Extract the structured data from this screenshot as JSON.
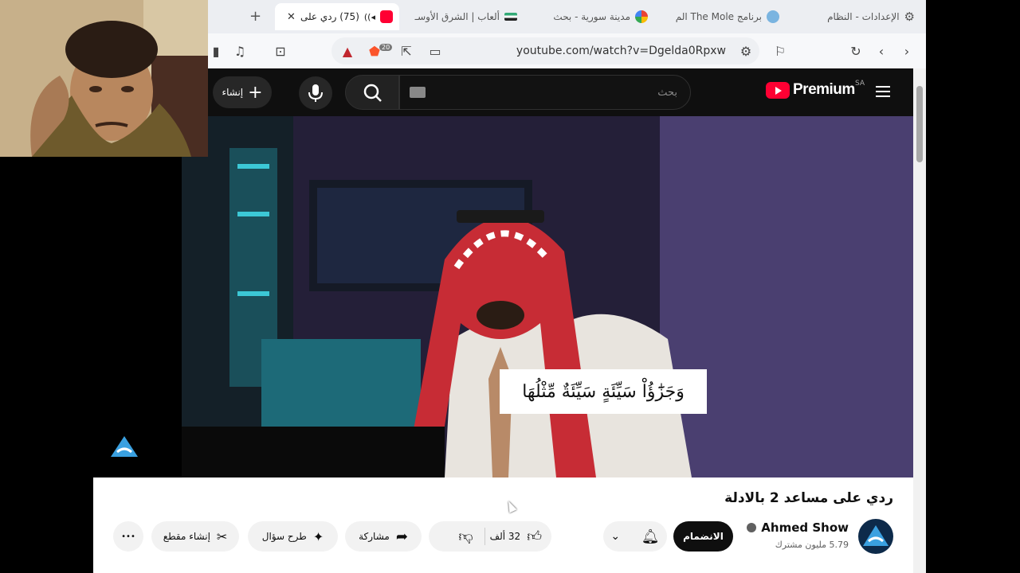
{
  "browser": {
    "tabs": [
      {
        "label": "الإعدادات - النظام",
        "icon": "gear-icon"
      },
      {
        "label": "برنامج The Mole الم",
        "icon": "globe-icon"
      },
      {
        "label": "مدينة سورية - بحث",
        "icon": "google-icon"
      },
      {
        "label": "ألعاب | الشرق الأوسـ",
        "icon": "flag-icon"
      },
      {
        "label": "(75) ردي على",
        "icon": "youtube-icon",
        "active": true
      }
    ],
    "new_tab_label": "+",
    "url": "youtube.com/watch?v=Dgelda0Rpxw",
    "brave_badge": "20"
  },
  "youtube": {
    "create_label": "إنشاء",
    "search_placeholder": "بحث",
    "logo_text": "Premium",
    "region": "SA",
    "caption_text": "وَجَزَٰٓؤُاْ سَيِّئَةٍ سَيِّئَةٌ مِّثْلُهَا",
    "video_title": "ردي على مساعد 2 بالادلة",
    "channel": {
      "name": "Ahmed Show",
      "subscribers": "5.79 مليون مشترك"
    },
    "join_label": "الانضمام",
    "like_count": "32 ألف",
    "share_label": "مشاركة",
    "ask_label": "طرح سؤال",
    "clip_label": "إنشاء مقطع",
    "more_label": "•••"
  },
  "colors": {
    "yt_red": "#ff0033",
    "yt_dark": "#0f0f0f"
  }
}
